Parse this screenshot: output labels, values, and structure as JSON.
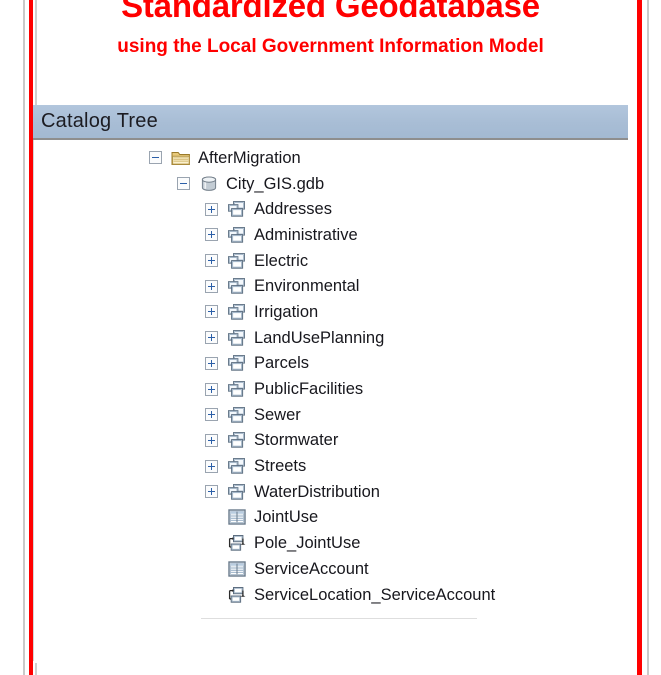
{
  "slide": {
    "title": "Standardized Geodatabase",
    "subtitle": "using the Local Government Information Model",
    "title_color": "#ff0000",
    "accent_border_color": "#ff0000"
  },
  "panel": {
    "header_title": "Catalog Tree",
    "header_background": "#a8bdd5"
  },
  "tree": {
    "items": [
      {
        "label": "AfterMigration",
        "icon": "folder-icon",
        "toggle": "minus",
        "depth": 0
      },
      {
        "label": "City_GIS.gdb",
        "icon": "geodatabase-icon",
        "toggle": "minus",
        "depth": 1
      },
      {
        "label": "Addresses",
        "icon": "feature-dataset-icon",
        "toggle": "plus",
        "depth": 2
      },
      {
        "label": "Administrative",
        "icon": "feature-dataset-icon",
        "toggle": "plus",
        "depth": 2
      },
      {
        "label": "Electric",
        "icon": "feature-dataset-icon",
        "toggle": "plus",
        "depth": 2
      },
      {
        "label": "Environmental",
        "icon": "feature-dataset-icon",
        "toggle": "plus",
        "depth": 2
      },
      {
        "label": "Irrigation",
        "icon": "feature-dataset-icon",
        "toggle": "plus",
        "depth": 2
      },
      {
        "label": "LandUsePlanning",
        "icon": "feature-dataset-icon",
        "toggle": "plus",
        "depth": 2
      },
      {
        "label": "Parcels",
        "icon": "feature-dataset-icon",
        "toggle": "plus",
        "depth": 2
      },
      {
        "label": "PublicFacilities",
        "icon": "feature-dataset-icon",
        "toggle": "plus",
        "depth": 2
      },
      {
        "label": "Sewer",
        "icon": "feature-dataset-icon",
        "toggle": "plus",
        "depth": 2
      },
      {
        "label": "Stormwater",
        "icon": "feature-dataset-icon",
        "toggle": "plus",
        "depth": 2
      },
      {
        "label": "Streets",
        "icon": "feature-dataset-icon",
        "toggle": "plus",
        "depth": 2
      },
      {
        "label": "WaterDistribution",
        "icon": "feature-dataset-icon",
        "toggle": "plus",
        "depth": 2
      },
      {
        "label": "JointUse",
        "icon": "table-icon",
        "toggle": "none",
        "depth": 2
      },
      {
        "label": "Pole_JointUse",
        "icon": "relationship-class-icon",
        "toggle": "none",
        "depth": 2
      },
      {
        "label": "ServiceAccount",
        "icon": "table-icon",
        "toggle": "none",
        "depth": 2
      },
      {
        "label": "ServiceLocation_ServiceAccount",
        "icon": "relationship-class-icon",
        "toggle": "none",
        "depth": 2
      }
    ]
  }
}
